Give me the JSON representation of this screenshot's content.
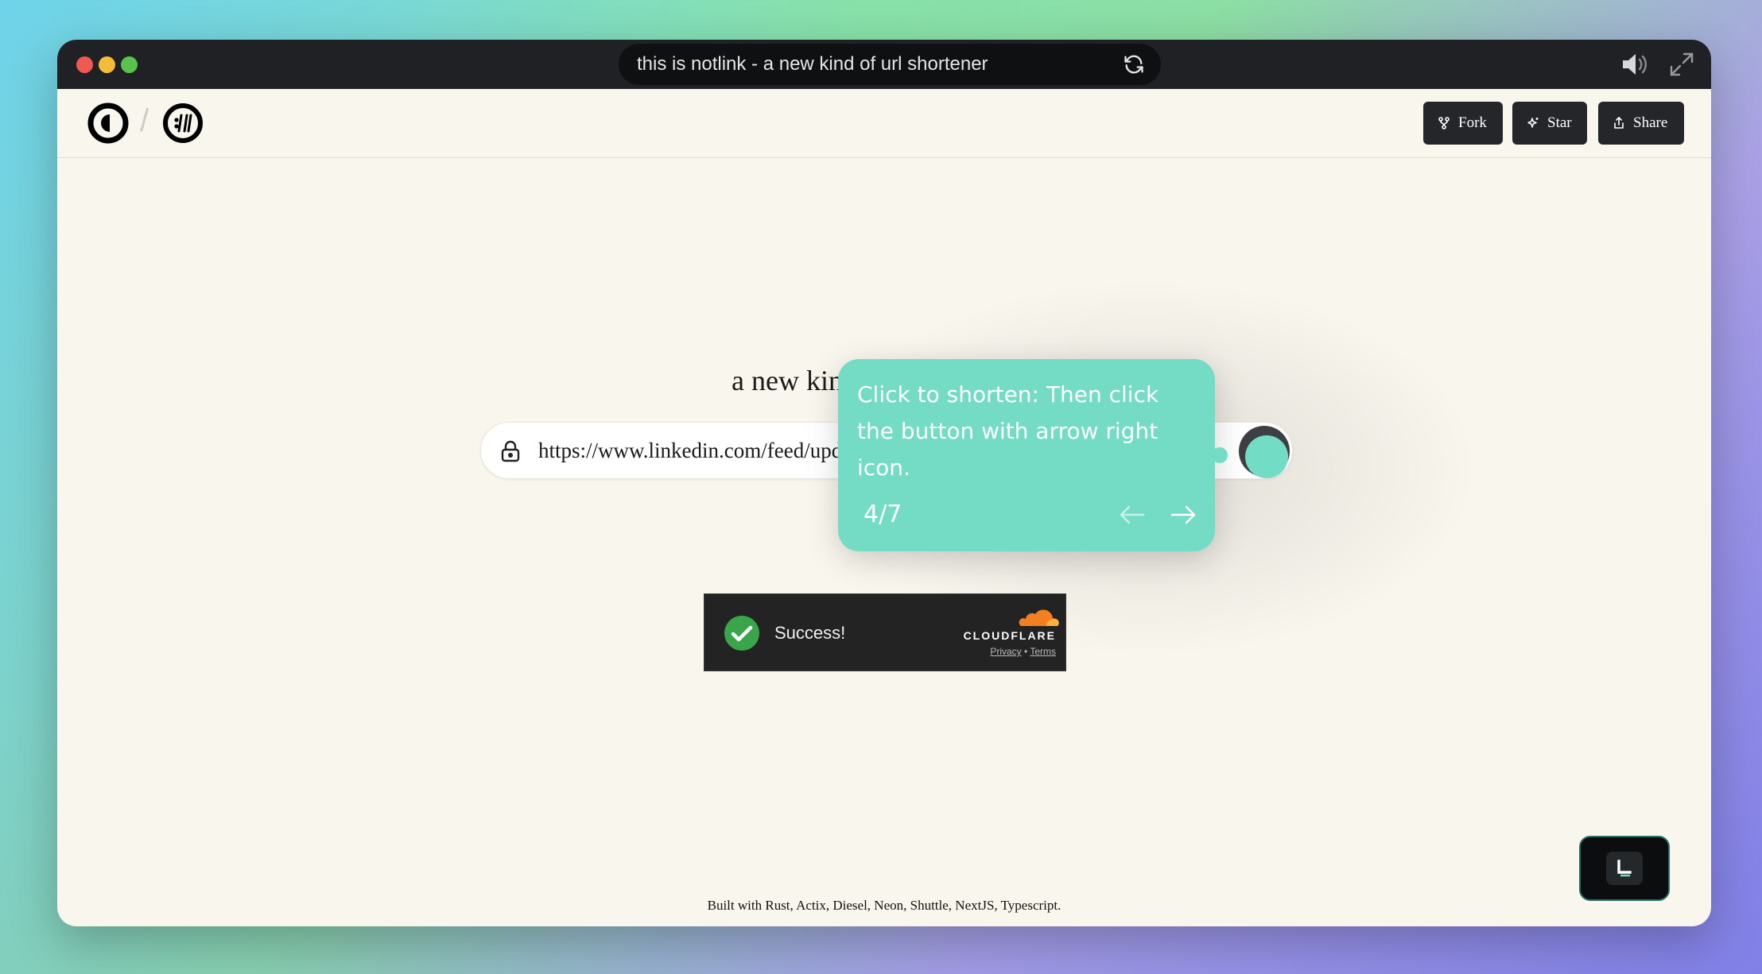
{
  "browser": {
    "tab_title": "this is notlink - a new kind of url shortener"
  },
  "header": {
    "fork_label": "Fork",
    "star_label": "Star",
    "share_label": "Share"
  },
  "main": {
    "headline_visible": "a new kin",
    "url_value": "https://www.linkedin.com/feed/upd"
  },
  "tour": {
    "text": "Click to shorten: Then click the button with arrow right icon.",
    "step": "4/7"
  },
  "captcha": {
    "status": "Success!",
    "brand": "CLOUDFLARE",
    "privacy": "Privacy",
    "separator": "•",
    "terms": "Terms"
  },
  "footer": {
    "text": "Built with Rust, Actix, Diesel, Neon, Shuttle, NextJS, Typescript."
  },
  "colors": {
    "accent": "#74dcc5",
    "dark": "#24262a",
    "page_bg": "#f9f6ee"
  }
}
